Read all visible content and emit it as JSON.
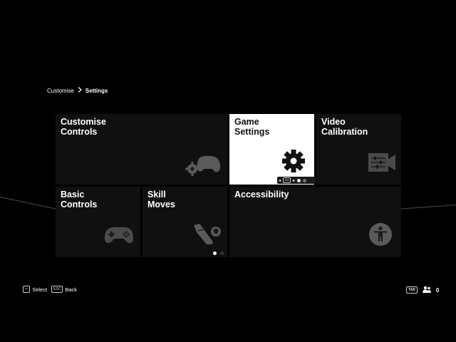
{
  "breadcrumb": {
    "parent": "Customise",
    "current": "Settings"
  },
  "tiles": [
    {
      "label": "Customise\nControls",
      "icon": "gamepad-gear-icon",
      "active": false
    },
    {
      "label": "Game\nSettings",
      "icon": "gear-icon",
      "active": true
    },
    {
      "label": "Video\nCalibration",
      "icon": "video-calibration-icon",
      "active": false
    },
    {
      "label": "Basic\nControls",
      "icon": "gamepad-icon",
      "active": false
    },
    {
      "label": "Skill\nMoves",
      "icon": "skill-moves-icon",
      "active": false
    },
    {
      "label": "Accessibility",
      "icon": "accessibility-icon",
      "active": false
    }
  ],
  "game_settings_pill": {
    "key": "R3"
  },
  "pager": {
    "total": 2,
    "current": 1
  },
  "footer": {
    "select_key": "↵",
    "select_label": "Select",
    "back_key": "ESC",
    "back_label": "Back",
    "tab_key": "TAB",
    "friends_count": "0"
  },
  "colors": {
    "active_tile": "#ffffff",
    "tile": "#141414",
    "accent": "#ffffff"
  }
}
